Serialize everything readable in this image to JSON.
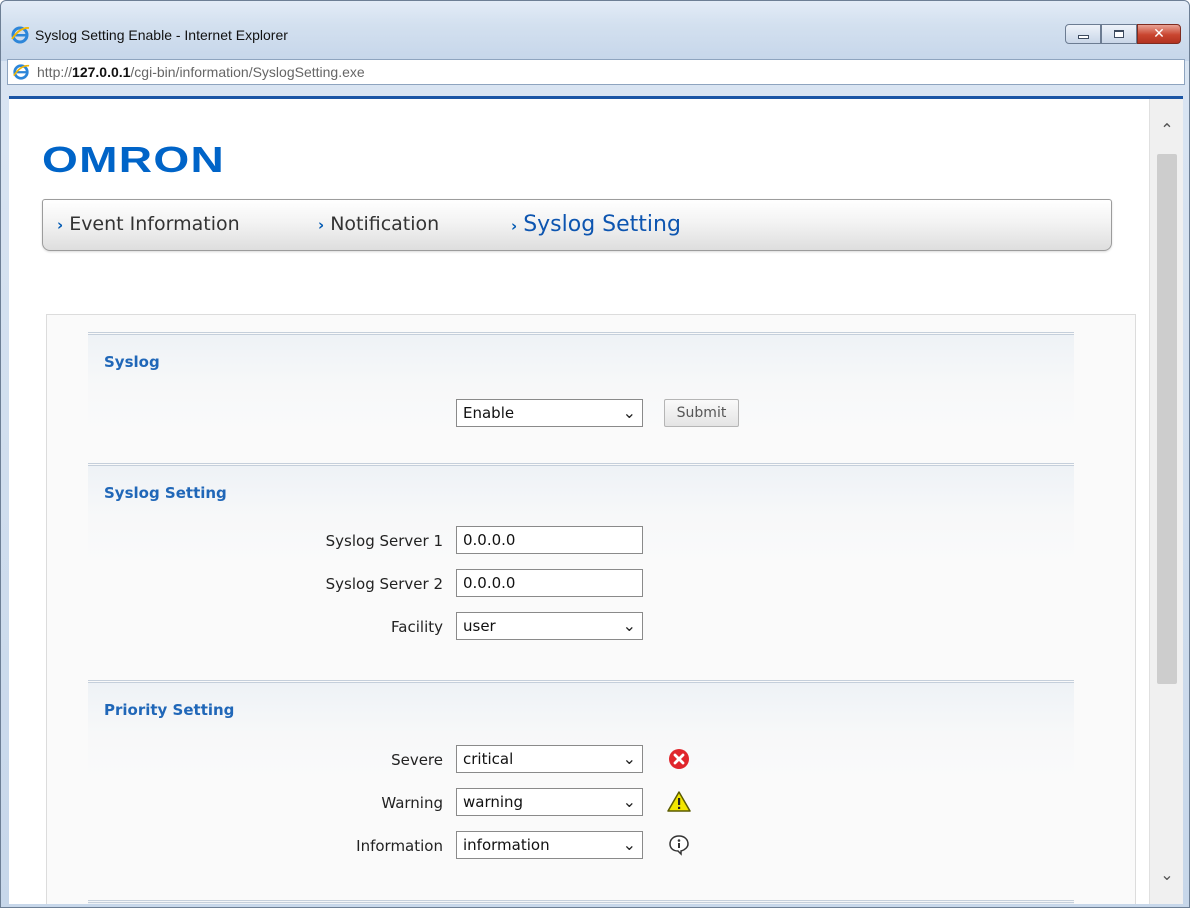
{
  "window": {
    "title": "Syslog Setting Enable - Internet Explorer",
    "url_prefix": "http://",
    "url_host": "127.0.0.1",
    "url_path": "/cgi-bin/information/SyslogSetting.exe"
  },
  "brand": {
    "logo_text": "OMRON",
    "color": "#0064c8"
  },
  "nav": {
    "items": [
      {
        "label": "Event Information",
        "active": false
      },
      {
        "label": "Notification",
        "active": false
      },
      {
        "label": "Syslog Setting",
        "active": true
      }
    ]
  },
  "syslog": {
    "title": "Syslog",
    "status_value": "Enable",
    "submit_label": "Submit"
  },
  "syslog_setting": {
    "title": "Syslog Setting",
    "server1_label": "Syslog Server 1",
    "server1_value": "0.0.0.0",
    "server2_label": "Syslog Server 2",
    "server2_value": "0.0.0.0",
    "facility_label": "Facility",
    "facility_value": "user"
  },
  "priority": {
    "title": "Priority Setting",
    "severe_label": "Severe",
    "severe_value": "critical",
    "warning_label": "Warning",
    "warning_value": "warning",
    "information_label": "Information",
    "information_value": "information"
  },
  "icons": {
    "severe": "error-icon",
    "warning": "warning-icon",
    "information": "info-icon"
  },
  "colors": {
    "accent": "#2067b8",
    "error": "#e0262c",
    "warning": "#f2e600"
  }
}
